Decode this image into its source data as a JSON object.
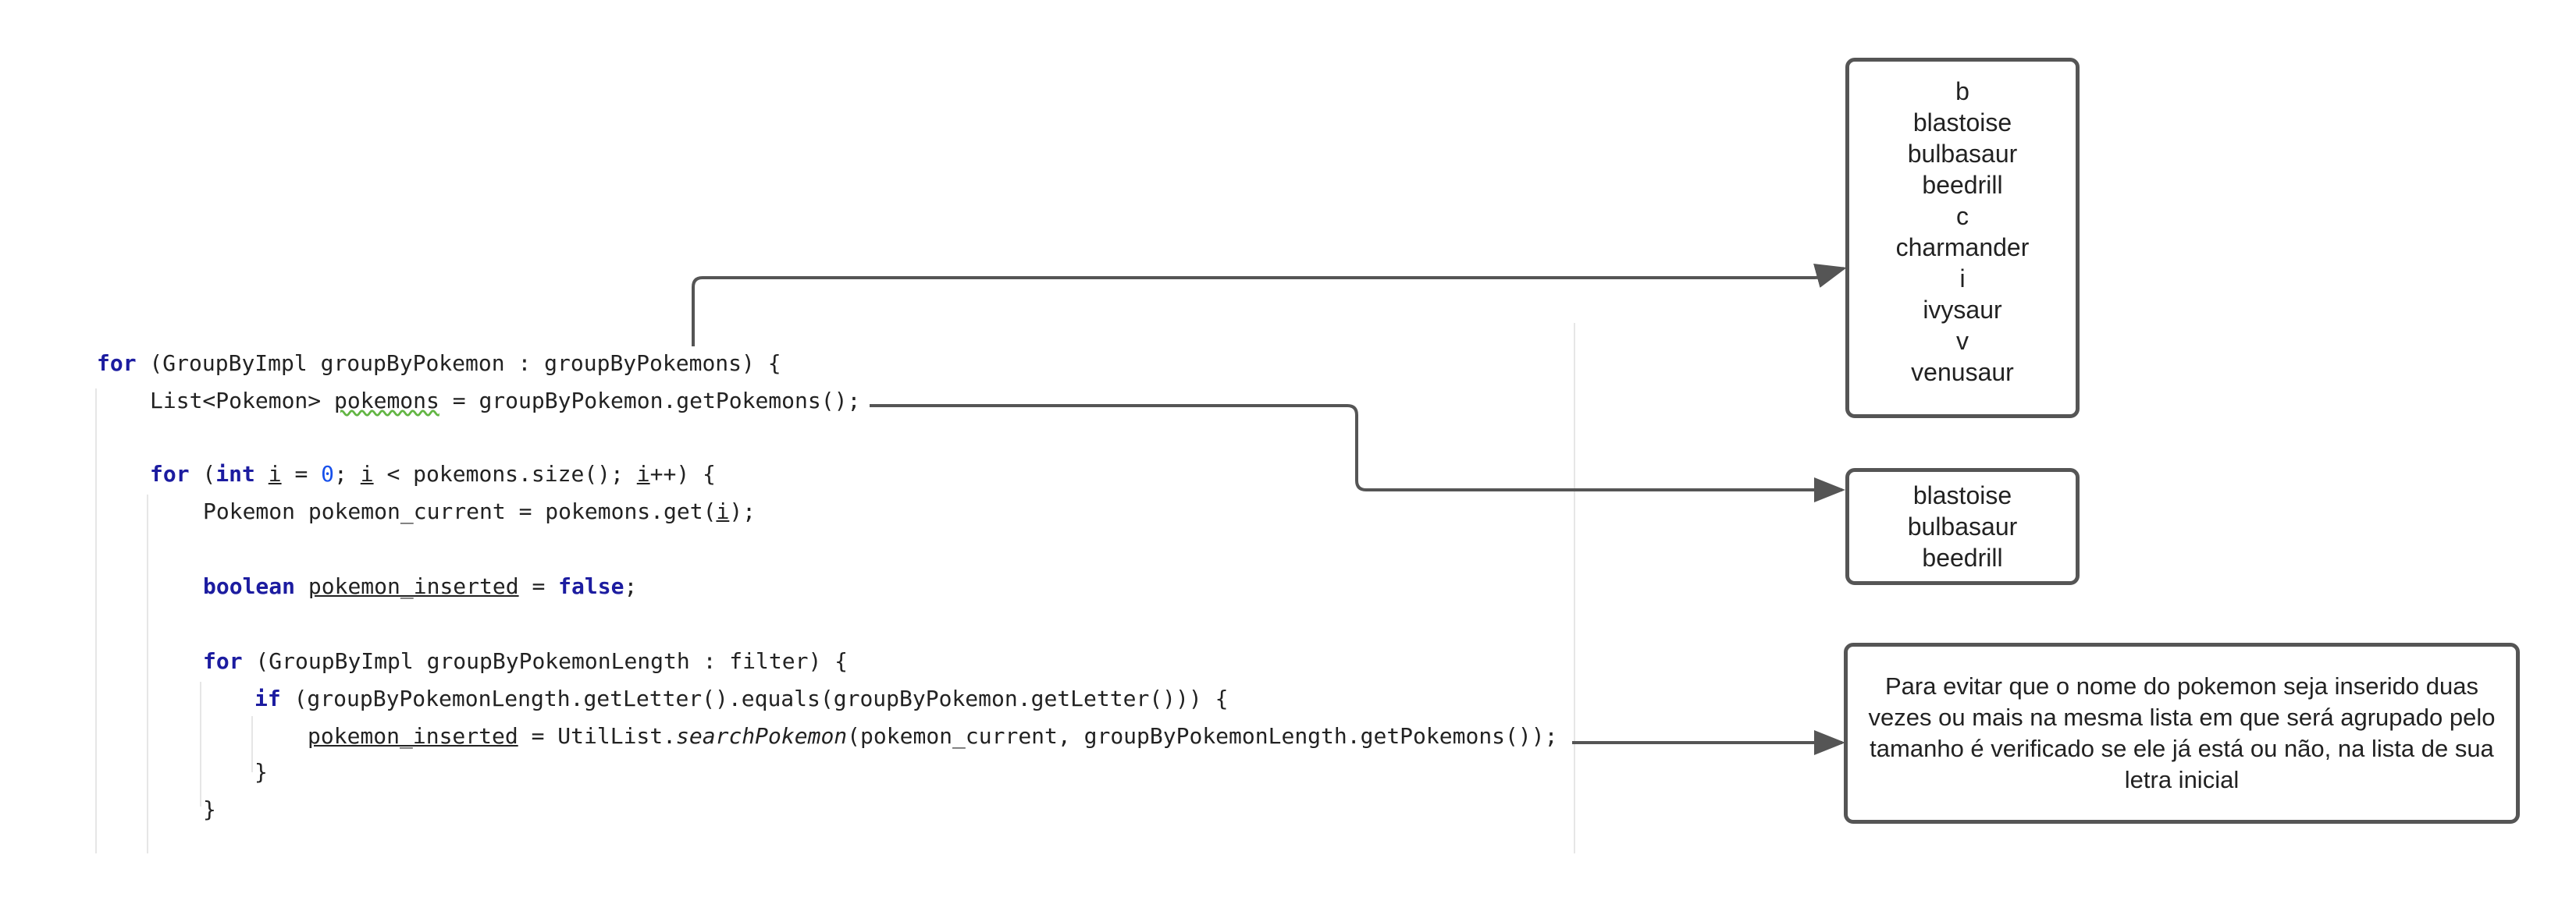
{
  "code_lines": [
    {
      "segments": [
        {
          "t": "for",
          "k": "kw"
        },
        {
          "t": " (GroupByImpl groupByPokemon : groupByPokemons) {"
        }
      ]
    },
    {
      "segments": [
        {
          "t": "List<Pokemon> "
        },
        {
          "t": "pokemons",
          "k": "wavy"
        },
        {
          "t": " = groupByPokemon.getPokemons();"
        }
      ]
    },
    {
      "segments": [
        {
          "t": "for",
          "k": "kw"
        },
        {
          "t": " ("
        },
        {
          "t": "int",
          "k": "kw"
        },
        {
          "t": " "
        },
        {
          "t": "i",
          "k": "ul"
        },
        {
          "t": " = "
        },
        {
          "t": "0",
          "k": "num"
        },
        {
          "t": "; "
        },
        {
          "t": "i",
          "k": "ul"
        },
        {
          "t": " < pokemons.size(); "
        },
        {
          "t": "i",
          "k": "ul"
        },
        {
          "t": "++) {"
        }
      ]
    },
    {
      "segments": [
        {
          "t": "Pokemon pokemon_current = pokemons.get("
        },
        {
          "t": "i",
          "k": "ul"
        },
        {
          "t": ");"
        }
      ]
    },
    {
      "segments": [
        {
          "t": "boolean",
          "k": "kw"
        },
        {
          "t": " "
        },
        {
          "t": "pokemon_inserted",
          "k": "ul"
        },
        {
          "t": " = "
        },
        {
          "t": "false",
          "k": "kw"
        },
        {
          "t": ";"
        }
      ]
    },
    {
      "segments": [
        {
          "t": "for",
          "k": "kw"
        },
        {
          "t": " (GroupByImpl groupByPokemonLength : filter) {"
        }
      ]
    },
    {
      "segments": [
        {
          "t": "if",
          "k": "kw"
        },
        {
          "t": " (groupByPokemonLength.getLetter().equals(groupByPokemon.getLetter())) {"
        }
      ]
    },
    {
      "segments": [
        {
          "t": "pokemon_inserted",
          "k": "ul"
        },
        {
          "t": " = UtilList."
        },
        {
          "t": "searchPokemon",
          "k": "it"
        },
        {
          "t": "(pokemon_current, groupByPokemonLength.getPokemons());"
        }
      ]
    },
    {
      "segments": [
        {
          "t": "}"
        }
      ]
    },
    {
      "segments": [
        {
          "t": "}"
        }
      ]
    }
  ],
  "box_groups": {
    "items": [
      "b",
      "blastoise",
      "bulbasaur",
      "beedrill",
      "c",
      "charmander",
      "i",
      "ivysaur",
      "v",
      "venusaur"
    ]
  },
  "box_pokemons": {
    "items": [
      "blastoise",
      "bulbasaur",
      "beedrill"
    ]
  },
  "box_note": {
    "text": "Para evitar que o nome do pokemon seja inserido duas vezes ou mais na mesma lista em que será agrupado pelo tamanho é verificado se ele já está ou não, na lista de sua letra inicial"
  },
  "colors": {
    "keyword": "#1c1ca0",
    "number": "#1750eb",
    "border": "#555555",
    "arrow": "#555555"
  }
}
